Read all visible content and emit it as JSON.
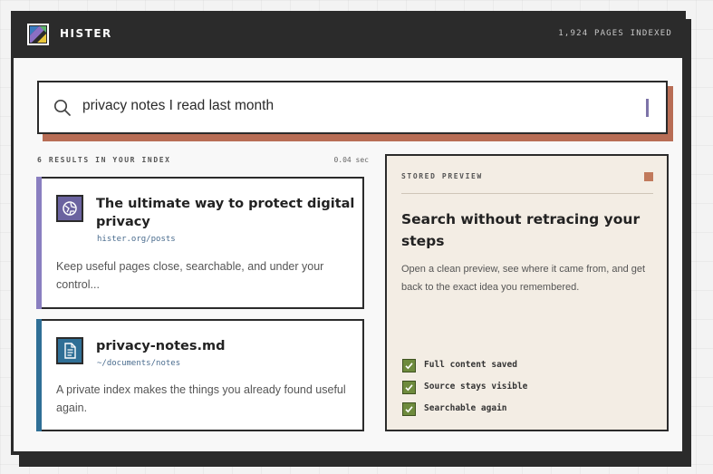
{
  "app": {
    "brand": "HISTER",
    "pages_indexed": "1,924 PAGES INDEXED"
  },
  "search": {
    "query": "privacy notes I read last month",
    "icon": "search-icon"
  },
  "results_meta": {
    "count_label": "6 RESULTS IN YOUR INDEX",
    "time": "0.04 sec"
  },
  "results": [
    {
      "title": "The ultimate way to protect digital privacy",
      "url": "hister.org/posts",
      "description": "Keep useful pages close, searchable, and under your control...",
      "icon": "globe-icon",
      "accent": "#8a7fc0",
      "icon_bg": "#6b63a0"
    },
    {
      "title": "privacy-notes.md",
      "url": "~/documents/notes",
      "description": "A private index makes the things you already found useful again.",
      "icon": "document-icon",
      "accent": "#2f6f96",
      "icon_bg": "#2f6f96"
    }
  ],
  "preview": {
    "label": "STORED PREVIEW",
    "title": "Search without retracing your steps",
    "description": "Open a clean preview, see where it came from, and get back to the exact idea you remembered.",
    "checks": [
      "Full content saved",
      "Source stays visible",
      "Searchable again"
    ],
    "check_color": "#6e8b3d",
    "marker_color": "#c17a5c"
  }
}
